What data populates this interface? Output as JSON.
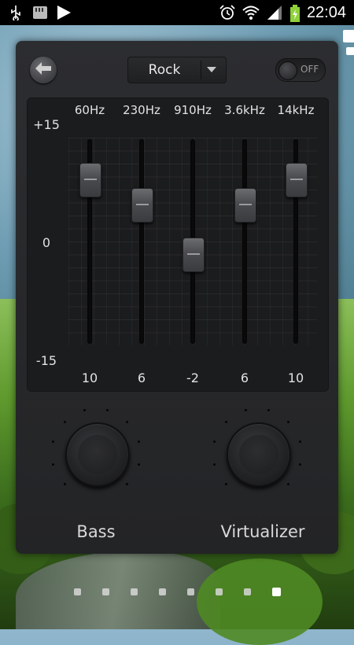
{
  "status_bar": {
    "time": "22:04",
    "left_icons": [
      "usb-icon",
      "sd-card-icon",
      "play-icon"
    ],
    "right_icons": [
      "alarm-icon",
      "wifi-icon",
      "signal-icon",
      "battery-charging-icon"
    ]
  },
  "toolbar": {
    "back_icon": "back-arrow-icon",
    "preset": "Rock",
    "dropdown_icon": "chevron-down-icon",
    "power_toggle_label": "OFF"
  },
  "equalizer": {
    "scale": {
      "max": "+15",
      "mid": "0",
      "min": "-15"
    },
    "bands": [
      {
        "freq": "60Hz",
        "gain_label": "10",
        "gain": 10
      },
      {
        "freq": "230Hz",
        "gain_label": "6",
        "gain": 6
      },
      {
        "freq": "910Hz",
        "gain_label": "-2",
        "gain": -2
      },
      {
        "freq": "3.6kHz",
        "gain_label": "6",
        "gain": 6
      },
      {
        "freq": "14kHz",
        "gain_label": "10",
        "gain": 10
      }
    ]
  },
  "effects": {
    "bass_label": "Bass",
    "virtualizer_label": "Virtualizer"
  },
  "home_pages": {
    "count": 8,
    "active_index": 7
  },
  "colors": {
    "panel": "#2c2d30",
    "eq_bg": "#1b1c1e",
    "text": "#e2e2e2",
    "status_bar": "#000000"
  }
}
